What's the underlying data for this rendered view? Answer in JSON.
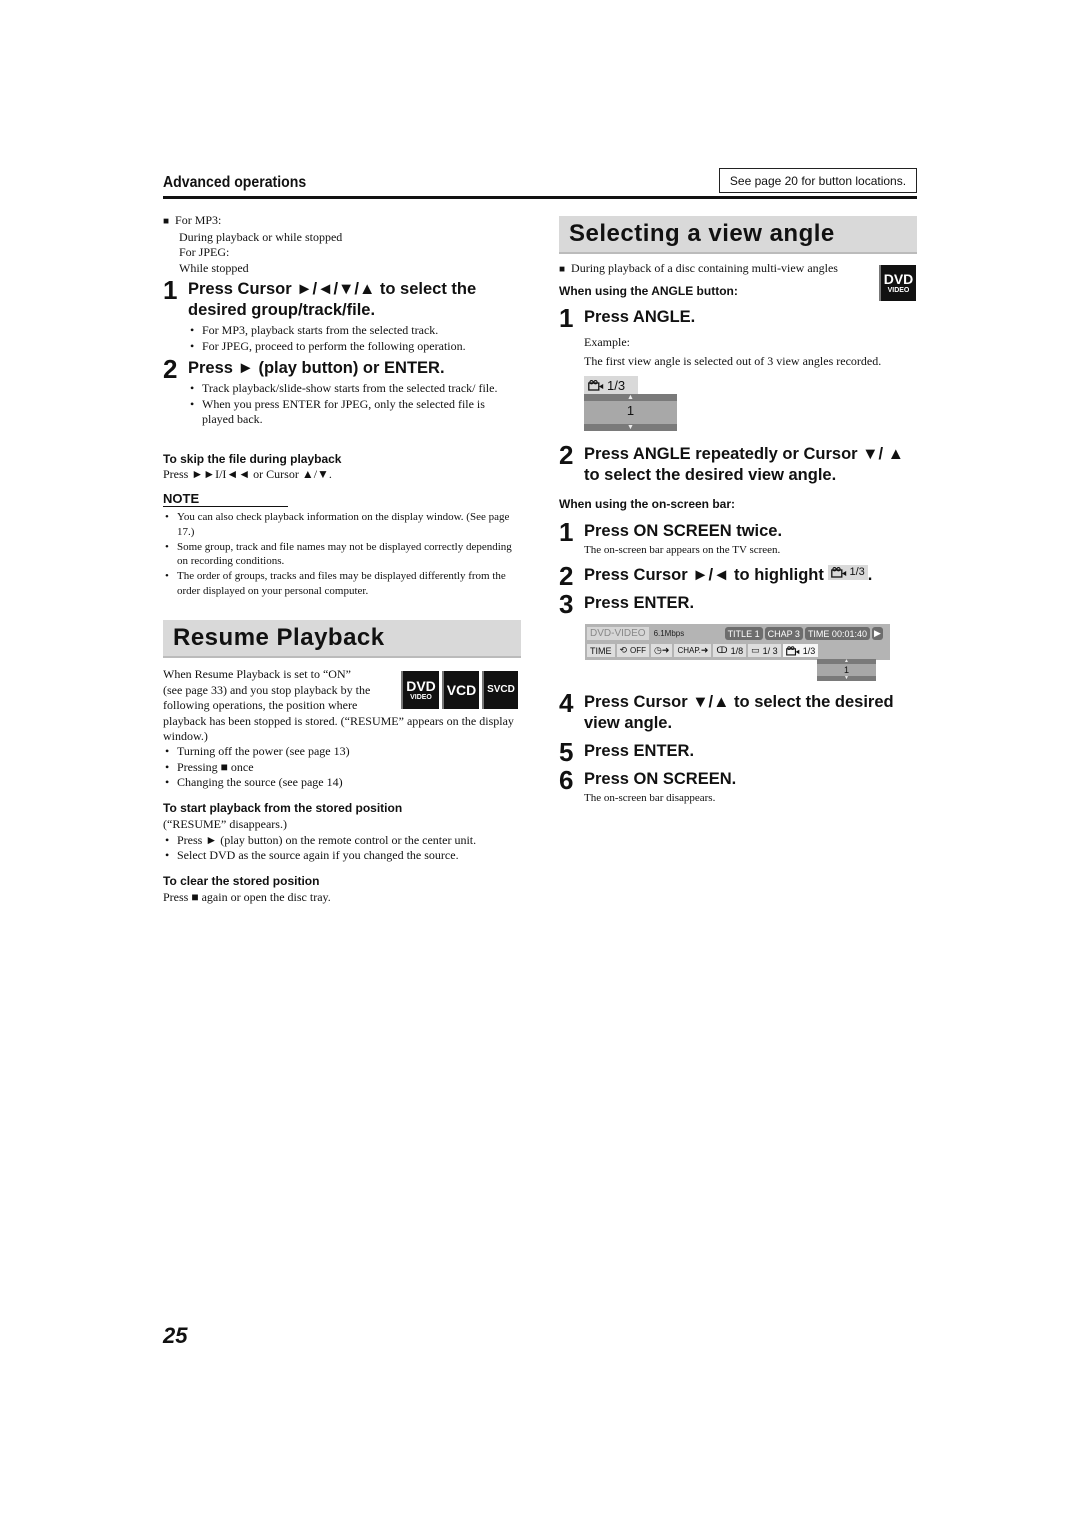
{
  "header": {
    "section_label": "Advanced operations",
    "see_page_note": "See page 20 for button locations."
  },
  "left": {
    "conditions": {
      "mp3_label": "For MP3:",
      "mp3_when": "During playback or while stopped",
      "jpeg_label": "For JPEG:",
      "jpeg_when": "While stopped"
    },
    "steps": [
      {
        "num": "1",
        "text": "Press Cursor ►/◄/▼/▲ to select the desired group/track/file.",
        "bullets": [
          "For MP3, playback starts from the selected track.",
          "For JPEG, proceed to perform the following operation."
        ]
      },
      {
        "num": "2",
        "text": "Press ► (play button) or ENTER.",
        "bullets": [
          "Track playback/slide-show starts from the selected track/ file.",
          "When you press ENTER for JPEG, only the selected file is played back."
        ]
      }
    ],
    "skip": {
      "title": "To skip the file during playback",
      "text": "Press ►►I/I◄◄ or Cursor ▲/▼."
    },
    "note": {
      "title": "NOTE",
      "items": [
        "You can also check playback information on the display window. (See page 17.)",
        "Some group, track and file names may not be displayed correctly depending on recording conditions.",
        "The order of groups, tracks and files may be displayed differently from the order displayed on your personal computer."
      ]
    },
    "resume": {
      "title": "Resume Playback",
      "intro_lines": [
        "When Resume Playback is set to “ON”",
        "(see page 33) and you stop playback by the",
        "following operations, the position where"
      ],
      "intro_rest": "playback has been stopped is stored. (“RESUME” appears on the display window.)",
      "badges": [
        {
          "big": "DVD",
          "small": "VIDEO"
        },
        {
          "big": "VCD",
          "small": ""
        },
        {
          "big": "SVCD",
          "small": ""
        }
      ],
      "operations": [
        "Turning off the power (see page 13)",
        "Pressing ■ once",
        "Changing the source (see page 14)"
      ],
      "start": {
        "title": "To start playback from the stored position",
        "note": "(“RESUME” disappears.)",
        "items": [
          "Press ► (play button) on the remote control or the center unit.",
          "Select DVD as the source again if you changed the source."
        ]
      },
      "clear": {
        "title": "To clear the stored position",
        "text": "Press ■ again or open the disc tray."
      }
    }
  },
  "right": {
    "title": "Selecting a view angle",
    "condition": "During playback of a disc containing multi-view angles",
    "badge": {
      "big": "DVD",
      "small": "VIDEO"
    },
    "angle_button": {
      "heading": "When using the ANGLE button:",
      "step1": {
        "num": "1",
        "text": "Press ANGLE."
      },
      "example_label": "Example:",
      "example_text": "The first view angle is selected out of 3 view angles recorded.",
      "osd": {
        "icon": "camera-angle-icon",
        "value": "1/3",
        "current": "1"
      },
      "step2": {
        "num": "2",
        "text": "Press ANGLE repeatedly or Cursor ▼/ ▲ to select the desired view angle."
      }
    },
    "onscreen": {
      "heading": "When using the on-screen bar:",
      "steps": [
        {
          "num": "1",
          "text": "Press ON SCREEN twice.",
          "sub": "The on-screen bar appears on the TV screen."
        },
        {
          "num": "2",
          "text_before": "Press Cursor ►/◄ to highlight",
          "chip": "1/3",
          "text_after": "."
        },
        {
          "num": "3",
          "text": "Press ENTER."
        },
        {
          "num": "4",
          "text": "Press Cursor ▼/▲ to select the desired view angle."
        },
        {
          "num": "5",
          "text": "Press ENTER."
        },
        {
          "num": "6",
          "text": "Press ON SCREEN.",
          "sub": "The on-screen bar disappears."
        }
      ],
      "bar": {
        "disc_type": "DVD-VIDEO",
        "bitrate": "6.1Mbps",
        "title": "TITLE  1",
        "chapter": "CHAP  3",
        "time": "TIME 00:01:40",
        "play_icon": "play-icon",
        "row2": {
          "time_label": "TIME",
          "repeat": "OFF",
          "chap_label": "CHAP.",
          "audio": "1/8",
          "subtitle": "1/ 3",
          "angle": "1/3"
        },
        "angle_current": "1"
      }
    }
  },
  "footer": {
    "page_number": "25"
  }
}
